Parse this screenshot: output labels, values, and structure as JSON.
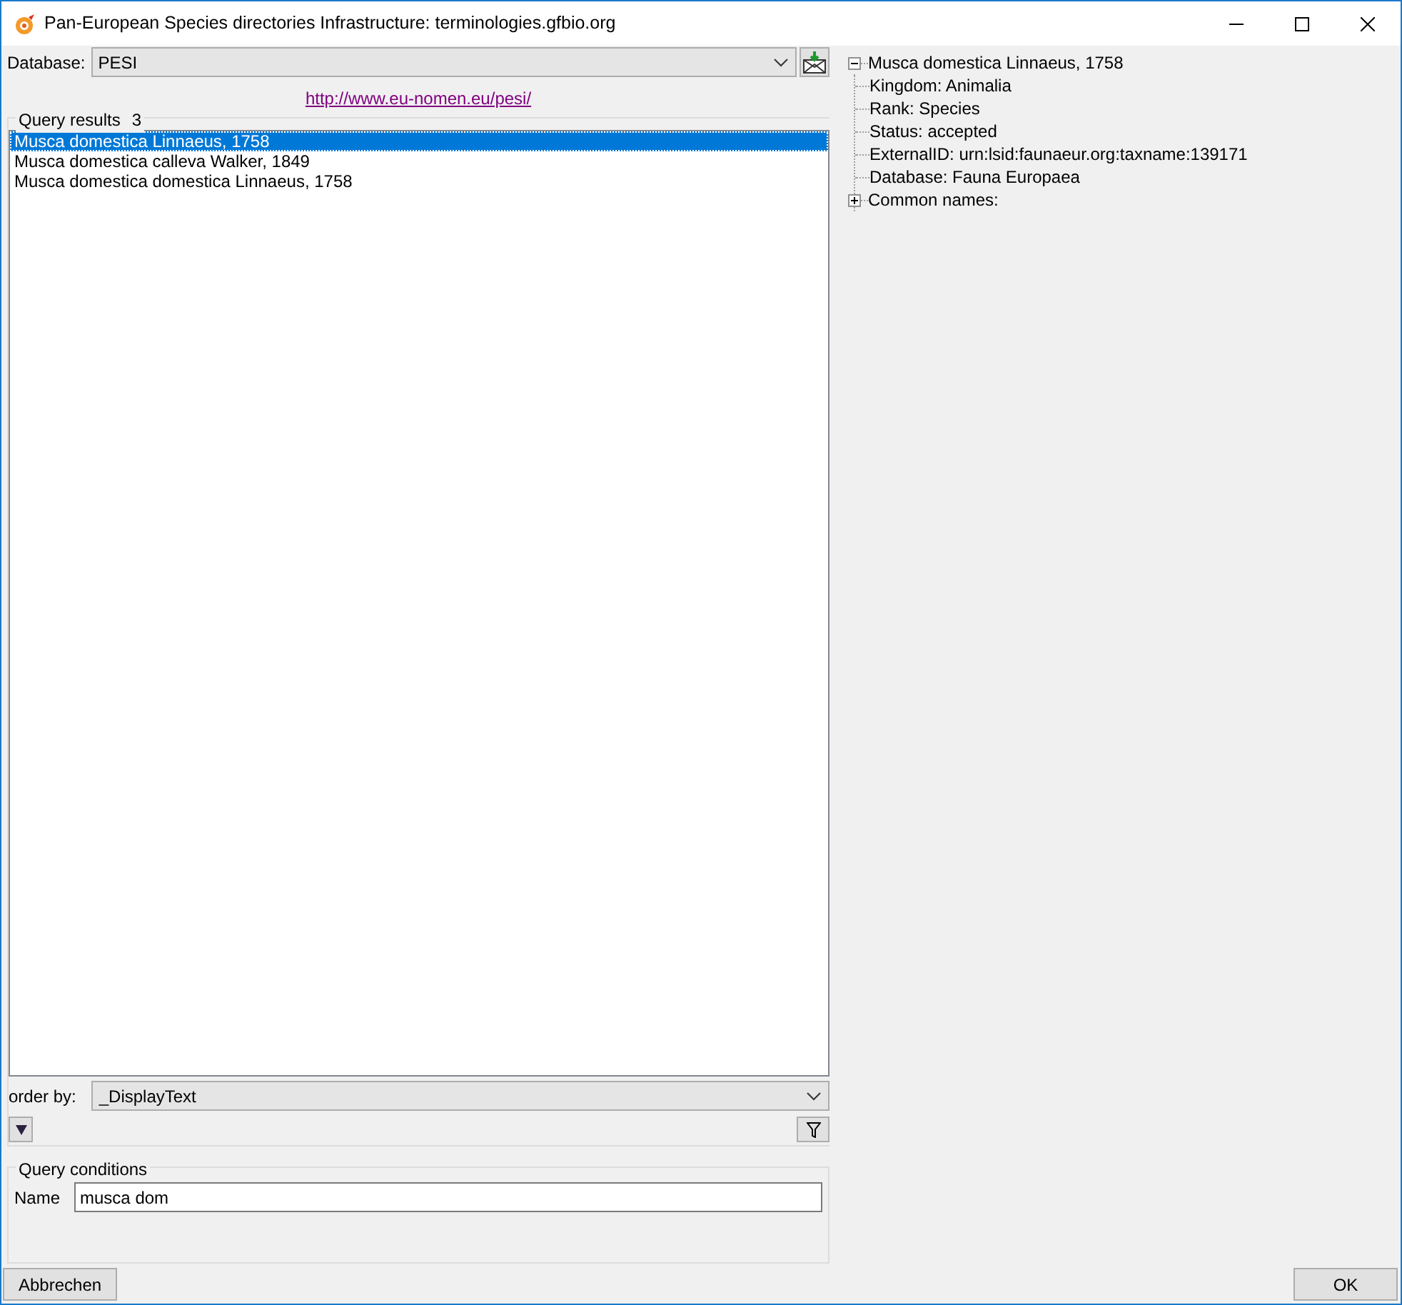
{
  "window": {
    "title": "Pan-European Species directories Infrastructure: terminologies.gfbio.org"
  },
  "database": {
    "label": "Database:",
    "value": "PESI",
    "link": "http://www.eu-nomen.eu/pesi/"
  },
  "query_results": {
    "label": "Query results",
    "count": "3",
    "rows": [
      {
        "text": "Musca domestica Linnaeus, 1758",
        "selected": true
      },
      {
        "text": "Musca domestica calleva Walker, 1849",
        "selected": false
      },
      {
        "text": "Musca domestica domestica Linnaeus, 1758",
        "selected": false
      }
    ]
  },
  "order_by": {
    "label": "order by:",
    "value": "_DisplayText"
  },
  "query_conditions": {
    "title": "Query conditions",
    "fields": [
      {
        "label": "Name",
        "value": "musca dom"
      }
    ]
  },
  "tree": [
    {
      "label": "Musca domestica Linnaeus, 1758",
      "expanded": true,
      "children": [
        {
          "label": "Kingdom: Animalia"
        },
        {
          "label": "Rank: Species"
        },
        {
          "label": "Status: accepted"
        },
        {
          "label": "ExternalID: urn:lsid:faunaeur.org:taxname:139171"
        },
        {
          "label": "Database: Fauna Europaea"
        },
        {
          "label": "Common names:",
          "expanded": false
        }
      ]
    }
  ],
  "buttons": {
    "cancel": "Abbrechen",
    "ok": "OK"
  }
}
